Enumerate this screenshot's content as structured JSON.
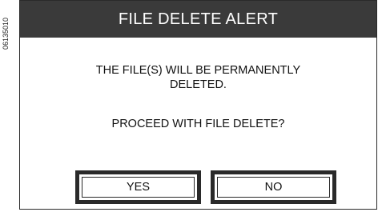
{
  "figure_code": "06135010",
  "dialog": {
    "title": "FILE DELETE ALERT",
    "message_lines": [
      "THE FILE(S) WILL BE PERMANENTLY",
      "DELETED."
    ],
    "prompt": "PROCEED WITH FILE DELETE?",
    "buttons": {
      "yes": "YES",
      "no": "NO"
    }
  },
  "colors": {
    "title_bar_bg": "#3a3a3a",
    "title_text": "#ffffff",
    "border": "#2a2a2a",
    "background": "#ffffff"
  }
}
